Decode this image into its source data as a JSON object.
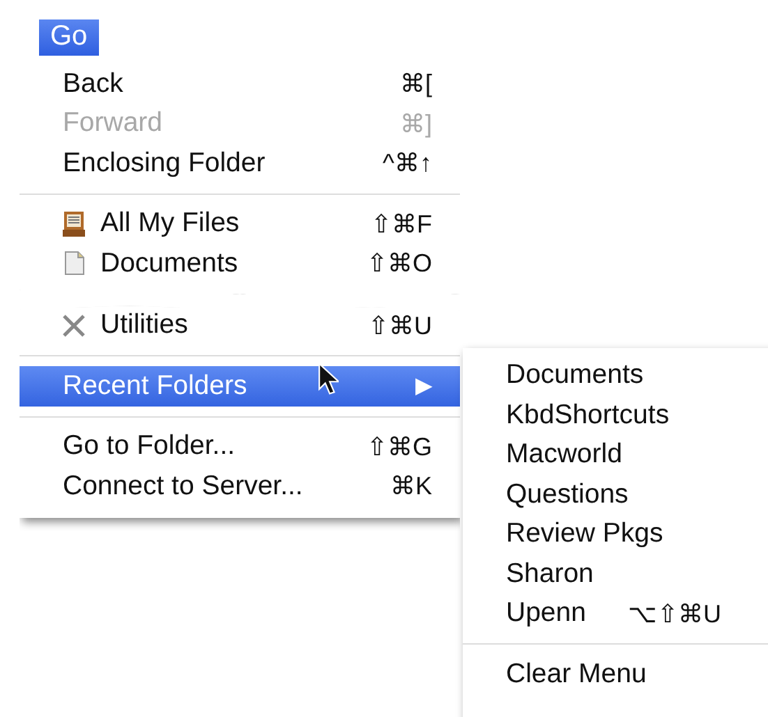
{
  "menu_title": {
    "label": "Go",
    "selected": true
  },
  "top_panel": {
    "items": [
      {
        "kind": "item",
        "label": "Back",
        "shortcut": "⌘[",
        "disabled": false
      },
      {
        "kind": "item",
        "label": "Forward",
        "shortcut": "⌘]",
        "disabled": true
      },
      {
        "kind": "item",
        "label": "Enclosing Folder",
        "shortcut": "^⌘↑",
        "disabled": false
      },
      {
        "kind": "separator"
      },
      {
        "kind": "file-item",
        "label": "All My Files",
        "shortcut": "⇧⌘F",
        "disabled": false
      },
      {
        "kind": "file-item",
        "label": "Documents",
        "shortcut": "⇧⌘O",
        "disabled": false
      }
    ]
  },
  "bottom_panel": {
    "items": [
      {
        "kind": "file-item",
        "label": "Utilities",
        "shortcut": "⇧⌘U",
        "disabled": false,
        "selected": false
      },
      {
        "kind": "separator"
      },
      {
        "kind": "submenu",
        "label": "Recent Folders",
        "arrow": "▶",
        "disabled": false,
        "selected": true
      },
      {
        "kind": "separator"
      },
      {
        "kind": "item",
        "label": "Go to Folder...",
        "shortcut": "⇧⌘G",
        "disabled": false,
        "selected": false
      },
      {
        "kind": "item",
        "label": "Connect to Server...",
        "shortcut": "⌘K",
        "disabled": false,
        "selected": false
      }
    ]
  },
  "submenu": {
    "items": [
      {
        "kind": "item",
        "label": "Documents"
      },
      {
        "kind": "item",
        "label": "KbdShortcuts"
      },
      {
        "kind": "item",
        "label": "Macworld"
      },
      {
        "kind": "item",
        "label": "Questions"
      },
      {
        "kind": "item",
        "label": "Review Pkgs"
      },
      {
        "kind": "item",
        "label": "Sharon"
      },
      {
        "kind": "item",
        "label": "Upenn",
        "shortcut": "⌥⇧⌘U"
      },
      {
        "kind": "separator"
      },
      {
        "kind": "item",
        "label": "Clear Menu"
      }
    ]
  }
}
